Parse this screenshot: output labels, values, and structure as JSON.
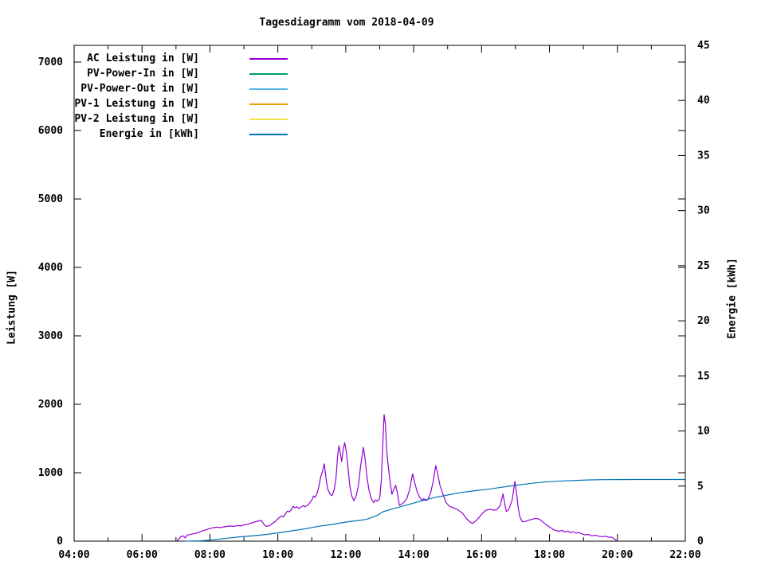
{
  "chart_data": {
    "type": "line",
    "title": "Tagesdiagramm vom 2018-04-09",
    "xlabel": "",
    "ylabel": "Leistung [W]",
    "y2label": "Energie [kWh]",
    "background_color": "#ffffff",
    "border_color": "#000000",
    "legend_position": "top-left-inside",
    "x_axis": {
      "range_hours": [
        4,
        22
      ],
      "major_ticks": [
        {
          "hour": 4,
          "label": "04:00"
        },
        {
          "hour": 6,
          "label": "06:00"
        },
        {
          "hour": 8,
          "label": "08:00"
        },
        {
          "hour": 10,
          "label": "10:00"
        },
        {
          "hour": 12,
          "label": "12:00"
        },
        {
          "hour": 14,
          "label": "14:00"
        },
        {
          "hour": 16,
          "label": "16:00"
        },
        {
          "hour": 18,
          "label": "18:00"
        },
        {
          "hour": 20,
          "label": "20:00"
        },
        {
          "hour": 22,
          "label": "22:00"
        }
      ],
      "minor_tick_hours": [
        5,
        7,
        9,
        11,
        13,
        15,
        17,
        19,
        21
      ]
    },
    "y_axis": {
      "label": "Leistung [W]",
      "min": 0,
      "tick_step": 1000,
      "ticks": [
        {
          "value": 0,
          "label": "0"
        },
        {
          "value": 1000,
          "label": "1000"
        },
        {
          "value": 2000,
          "label": "2000"
        },
        {
          "value": 3000,
          "label": "3000"
        },
        {
          "value": 4000,
          "label": "4000"
        },
        {
          "value": 5000,
          "label": "5000"
        },
        {
          "value": 6000,
          "label": "6000"
        },
        {
          "value": 7000,
          "label": "7000"
        }
      ]
    },
    "y2_axis": {
      "label": "Energie [kWh]",
      "min": 0,
      "max": 45,
      "tick_step": 5,
      "ticks": [
        {
          "value": 0,
          "label": "0"
        },
        {
          "value": 5,
          "label": "5"
        },
        {
          "value": 10,
          "label": "10"
        },
        {
          "value": 15,
          "label": "15"
        },
        {
          "value": 20,
          "label": "20"
        },
        {
          "value": 25,
          "label": "25"
        },
        {
          "value": 30,
          "label": "30"
        },
        {
          "value": 35,
          "label": "35"
        },
        {
          "value": 40,
          "label": "40"
        },
        {
          "value": 45,
          "label": "45"
        }
      ]
    },
    "series": [
      {
        "name": "AC Leistung in [W]",
        "color": "#9400d3",
        "axis": "y1",
        "points": [
          [
            7.03,
            5
          ],
          [
            7.08,
            30
          ],
          [
            7.14,
            62
          ],
          [
            7.19,
            78
          ],
          [
            7.23,
            70
          ],
          [
            7.27,
            48
          ],
          [
            7.33,
            88
          ],
          [
            7.42,
            98
          ],
          [
            7.52,
            108
          ],
          [
            7.62,
            120
          ],
          [
            7.72,
            138
          ],
          [
            7.85,
            162
          ],
          [
            8.0,
            185
          ],
          [
            8.1,
            196
          ],
          [
            8.2,
            205
          ],
          [
            8.3,
            198
          ],
          [
            8.4,
            208
          ],
          [
            8.5,
            215
          ],
          [
            8.6,
            222
          ],
          [
            8.7,
            215
          ],
          [
            8.8,
            228
          ],
          [
            8.9,
            222
          ],
          [
            9.0,
            238
          ],
          [
            9.1,
            248
          ],
          [
            9.2,
            262
          ],
          [
            9.3,
            278
          ],
          [
            9.4,
            292
          ],
          [
            9.52,
            302
          ],
          [
            9.58,
            252
          ],
          [
            9.65,
            215
          ],
          [
            9.75,
            225
          ],
          [
            9.85,
            262
          ],
          [
            9.95,
            298
          ],
          [
            10.03,
            340
          ],
          [
            10.1,
            368
          ],
          [
            10.16,
            355
          ],
          [
            10.22,
            395
          ],
          [
            10.28,
            440
          ],
          [
            10.33,
            428
          ],
          [
            10.4,
            462
          ],
          [
            10.45,
            510
          ],
          [
            10.5,
            488
          ],
          [
            10.56,
            502
          ],
          [
            10.62,
            476
          ],
          [
            10.68,
            496
          ],
          [
            10.74,
            520
          ],
          [
            10.8,
            502
          ],
          [
            10.9,
            532
          ],
          [
            11.0,
            600
          ],
          [
            11.05,
            660
          ],
          [
            11.1,
            640
          ],
          [
            11.16,
            705
          ],
          [
            11.21,
            800
          ],
          [
            11.26,
            935
          ],
          [
            11.31,
            1010
          ],
          [
            11.37,
            1130
          ],
          [
            11.42,
            905
          ],
          [
            11.47,
            762
          ],
          [
            11.54,
            685
          ],
          [
            11.6,
            665
          ],
          [
            11.66,
            755
          ],
          [
            11.71,
            905
          ],
          [
            11.76,
            1250
          ],
          [
            11.8,
            1395
          ],
          [
            11.84,
            1280
          ],
          [
            11.88,
            1165
          ],
          [
            11.93,
            1350
          ],
          [
            11.97,
            1440
          ],
          [
            12.02,
            1300
          ],
          [
            12.07,
            1055
          ],
          [
            12.12,
            805
          ],
          [
            12.18,
            655
          ],
          [
            12.24,
            592
          ],
          [
            12.3,
            655
          ],
          [
            12.37,
            805
          ],
          [
            12.44,
            1105
          ],
          [
            12.52,
            1370
          ],
          [
            12.57,
            1205
          ],
          [
            12.62,
            955
          ],
          [
            12.68,
            755
          ],
          [
            12.75,
            625
          ],
          [
            12.82,
            565
          ],
          [
            12.88,
            602
          ],
          [
            12.93,
            582
          ],
          [
            13.0,
            625
          ],
          [
            13.05,
            905
          ],
          [
            13.09,
            1400
          ],
          [
            13.13,
            1850
          ],
          [
            13.17,
            1705
          ],
          [
            13.21,
            1305
          ],
          [
            13.26,
            1055
          ],
          [
            13.31,
            855
          ],
          [
            13.36,
            685
          ],
          [
            13.42,
            765
          ],
          [
            13.47,
            815
          ],
          [
            13.52,
            705
          ],
          [
            13.58,
            525
          ],
          [
            13.65,
            545
          ],
          [
            13.72,
            572
          ],
          [
            13.8,
            625
          ],
          [
            13.88,
            755
          ],
          [
            13.97,
            985
          ],
          [
            14.03,
            855
          ],
          [
            14.1,
            725
          ],
          [
            14.17,
            645
          ],
          [
            14.24,
            602
          ],
          [
            14.3,
            622
          ],
          [
            14.36,
            592
          ],
          [
            14.42,
            612
          ],
          [
            14.5,
            705
          ],
          [
            14.58,
            885
          ],
          [
            14.65,
            1105
          ],
          [
            14.7,
            1005
          ],
          [
            14.77,
            825
          ],
          [
            14.85,
            705
          ],
          [
            14.95,
            565
          ],
          [
            15.05,
            512
          ],
          [
            15.15,
            492
          ],
          [
            15.25,
            472
          ],
          [
            15.35,
            442
          ],
          [
            15.45,
            402
          ],
          [
            15.55,
            332
          ],
          [
            15.65,
            282
          ],
          [
            15.73,
            258
          ],
          [
            15.85,
            302
          ],
          [
            15.95,
            362
          ],
          [
            16.05,
            422
          ],
          [
            16.15,
            456
          ],
          [
            16.25,
            466
          ],
          [
            16.35,
            452
          ],
          [
            16.45,
            462
          ],
          [
            16.55,
            522
          ],
          [
            16.63,
            692
          ],
          [
            16.68,
            552
          ],
          [
            16.73,
            432
          ],
          [
            16.8,
            462
          ],
          [
            16.9,
            602
          ],
          [
            16.98,
            872
          ],
          [
            17.03,
            702
          ],
          [
            17.08,
            482
          ],
          [
            17.13,
            352
          ],
          [
            17.2,
            282
          ],
          [
            17.3,
            288
          ],
          [
            17.4,
            308
          ],
          [
            17.5,
            322
          ],
          [
            17.6,
            332
          ],
          [
            17.7,
            322
          ],
          [
            17.8,
            282
          ],
          [
            17.9,
            242
          ],
          [
            18.0,
            208
          ],
          [
            18.1,
            172
          ],
          [
            18.2,
            152
          ],
          [
            18.3,
            146
          ],
          [
            18.38,
            158
          ],
          [
            18.45,
            132
          ],
          [
            18.55,
            148
          ],
          [
            18.62,
            122
          ],
          [
            18.7,
            138
          ],
          [
            18.78,
            118
          ],
          [
            18.85,
            128
          ],
          [
            18.95,
            108
          ],
          [
            19.05,
            92
          ],
          [
            19.15,
            98
          ],
          [
            19.25,
            78
          ],
          [
            19.35,
            88
          ],
          [
            19.45,
            72
          ],
          [
            19.55,
            66
          ],
          [
            19.65,
            72
          ],
          [
            19.75,
            56
          ],
          [
            19.82,
            62
          ],
          [
            19.88,
            42
          ],
          [
            19.94,
            22
          ],
          [
            20.0,
            0
          ]
        ]
      },
      {
        "name": "PV-Power-In in [W]",
        "color": "#009e73",
        "axis": "y1",
        "points": []
      },
      {
        "name": "PV-Power-Out in [W]",
        "color": "#56b4e9",
        "axis": "y1",
        "points": []
      },
      {
        "name": "PV-1 Leistung in [W]",
        "color": "#e69f00",
        "axis": "y1",
        "points": []
      },
      {
        "name": "PV-2 Leistung in [W]",
        "color": "#f0e442",
        "axis": "y1",
        "points": []
      },
      {
        "name": "Energie in [kWh]",
        "color": "#0072b2",
        "axis": "y2",
        "points": [
          [
            7.25,
            0
          ],
          [
            7.7,
            0.03
          ],
          [
            8.1,
            0.12
          ],
          [
            8.5,
            0.27
          ],
          [
            8.9,
            0.4
          ],
          [
            9.3,
            0.5
          ],
          [
            9.7,
            0.62
          ],
          [
            10.0,
            0.75
          ],
          [
            10.4,
            0.93
          ],
          [
            10.8,
            1.12
          ],
          [
            11.2,
            1.35
          ],
          [
            11.6,
            1.52
          ],
          [
            12.0,
            1.73
          ],
          [
            12.3,
            1.85
          ],
          [
            12.6,
            1.97
          ],
          [
            12.9,
            2.3
          ],
          [
            13.1,
            2.67
          ],
          [
            13.4,
            2.95
          ],
          [
            13.7,
            3.2
          ],
          [
            14.0,
            3.45
          ],
          [
            14.3,
            3.72
          ],
          [
            14.6,
            3.95
          ],
          [
            15.0,
            4.19
          ],
          [
            15.4,
            4.42
          ],
          [
            15.8,
            4.58
          ],
          [
            16.2,
            4.72
          ],
          [
            16.6,
            4.9
          ],
          [
            17.0,
            5.06
          ],
          [
            17.4,
            5.22
          ],
          [
            17.7,
            5.32
          ],
          [
            18.0,
            5.4
          ],
          [
            18.4,
            5.47
          ],
          [
            18.8,
            5.52
          ],
          [
            19.2,
            5.56
          ],
          [
            19.6,
            5.58
          ],
          [
            20.0,
            5.59
          ],
          [
            20.5,
            5.595
          ],
          [
            21.0,
            5.6
          ],
          [
            21.5,
            5.6
          ],
          [
            22.0,
            5.6
          ]
        ]
      }
    ]
  }
}
